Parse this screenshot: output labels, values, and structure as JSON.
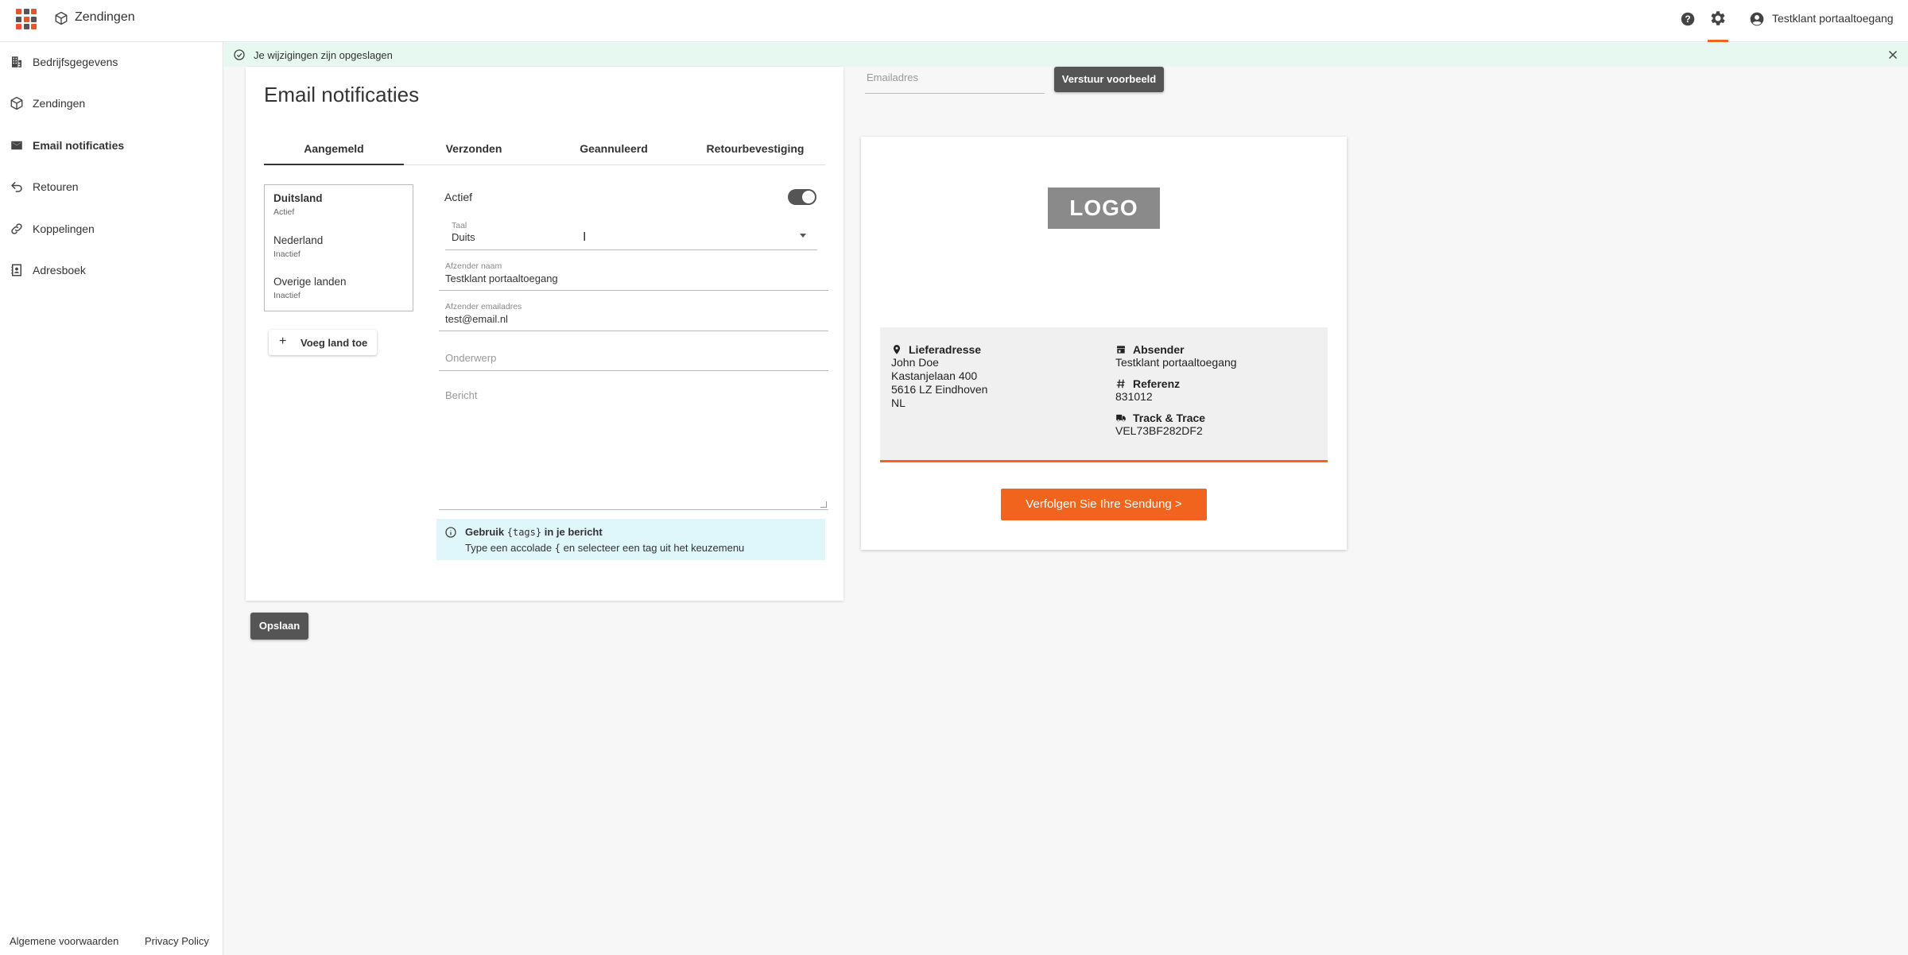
{
  "app": {
    "title": "Zendingen",
    "grid_colors": [
      "#e4572e",
      "#555555",
      "#e4572e",
      "#555555",
      "#e4572e",
      "#555555",
      "#e4572e",
      "#555555",
      "#e4572e"
    ],
    "accent": "#f0641e"
  },
  "topbar": {
    "help_icon": "help-circle-icon",
    "settings_icon": "gear-icon",
    "user_icon": "account-circle-icon",
    "user_name": "Testklant portaaltoegang"
  },
  "sidebar": {
    "items": [
      {
        "label": "Bedrijfsgegevens",
        "icon": "building-icon",
        "active": false
      },
      {
        "label": "Zendingen",
        "icon": "package-icon",
        "active": false
      },
      {
        "label": "Email notificaties",
        "icon": "mail-icon",
        "active": true
      },
      {
        "label": "Retouren",
        "icon": "undo-icon",
        "active": false
      },
      {
        "label": "Koppelingen",
        "icon": "link-icon",
        "active": false
      },
      {
        "label": "Adresboek",
        "icon": "contacts-icon",
        "active": false
      }
    ],
    "footer": {
      "terms": "Algemene voorwaarden",
      "privacy": "Privacy Policy"
    }
  },
  "notification": {
    "text": "Je wijzigingen zijn opgeslagen",
    "color": "#e6f8f0"
  },
  "main": {
    "title": "Email notificaties",
    "tabs": [
      {
        "label": "Aangemeld",
        "active": true
      },
      {
        "label": "Verzonden",
        "active": false
      },
      {
        "label": "Geannuleerd",
        "active": false
      },
      {
        "label": "Retourbevestiging",
        "active": false
      }
    ],
    "countries": [
      {
        "name": "Duitsland",
        "state": "Actief",
        "active": true
      },
      {
        "name": "Nederland",
        "state": "Inactief",
        "active": false
      },
      {
        "name": "Overige landen",
        "state": "Inactief",
        "active": false
      }
    ],
    "add_country_label": "Voeg land toe",
    "active_label": "Actief",
    "active_toggle": true,
    "language": {
      "label": "Taal",
      "value": "Duits"
    },
    "sender_name": {
      "label": "Afzender naam",
      "value": "Testklant portaaltoegang"
    },
    "sender_email": {
      "label": "Afzender emailadres",
      "value": "test@email.nl"
    },
    "subject": {
      "placeholder": "Onderwerp"
    },
    "message": {
      "placeholder": "Bericht"
    },
    "info": {
      "line1_prefix": "Gebruik",
      "line1_code": "{tags}",
      "line1_suffix": "in je bericht",
      "line2_prefix": "Type een accolade",
      "line2_code": "{",
      "line2_suffix": "en selecteer een tag uit het keuzemenu"
    },
    "save_label": "Opslaan"
  },
  "preview": {
    "email_placeholder": "Emailadres",
    "send_label": "Verstuur voorbeeld",
    "logo_text": "LOGO",
    "delivery": {
      "title": "Lieferadresse",
      "lines": [
        "John Doe",
        "Kastanjelaan 400",
        "5616 LZ Eindhoven",
        "NL"
      ]
    },
    "sender": {
      "title": "Absender",
      "value": "Testklant portaaltoegang"
    },
    "reference": {
      "title": "Referenz",
      "value": "831012"
    },
    "tracking": {
      "title": "Track & Trace",
      "value": "VEL73BF282DF2"
    },
    "track_button": "Verfolgen Sie Ihre Sendung >"
  }
}
